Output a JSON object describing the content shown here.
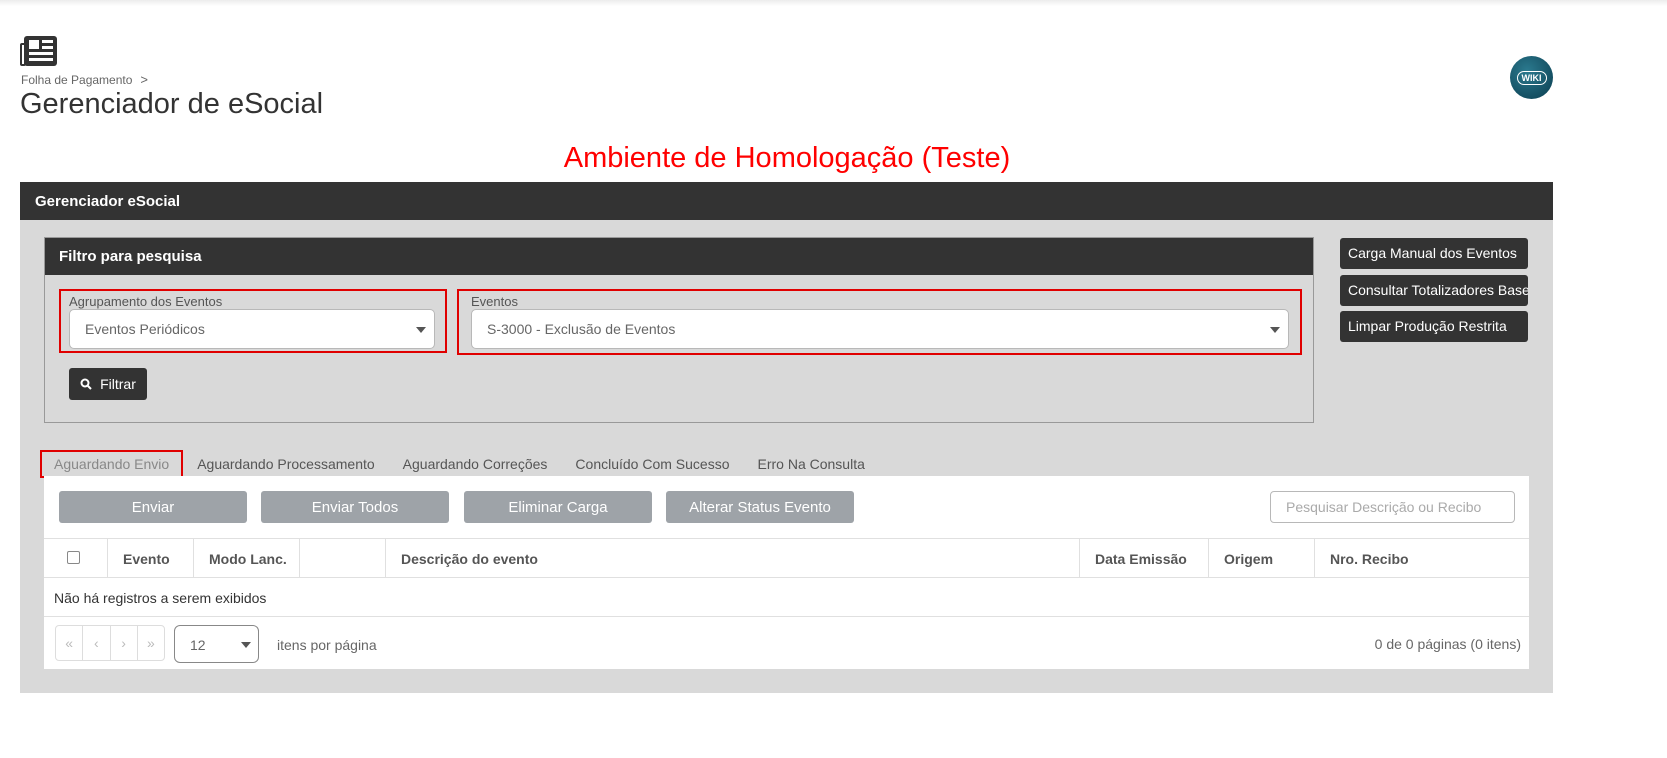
{
  "header": {
    "breadcrumb": "Folha de Pagamento",
    "breadcrumb_sep": ">",
    "title": "Gerenciador de eSocial",
    "wiki_label": "WIKI"
  },
  "environment_banner": "Ambiente de Homologação (Teste)",
  "panel": {
    "title": "Gerenciador eSocial",
    "filter": {
      "title": "Filtro para pesquisa",
      "grouping_label": "Agrupamento dos Eventos",
      "grouping_value": "Eventos Periódicos",
      "events_label": "Eventos",
      "events_value": "S-3000 - Exclusão de Eventos",
      "filter_button": "Filtrar"
    },
    "side_buttons": [
      "Carga Manual dos Eventos",
      "Consultar Totalizadores Base",
      "Limpar Produção Restrita"
    ]
  },
  "tabs": [
    "Aguardando Envio",
    "Aguardando Processamento",
    "Aguardando Correções",
    "Concluído Com Sucesso",
    "Erro Na Consulta"
  ],
  "active_tab": "Aguardando Envio",
  "actions": [
    "Enviar",
    "Enviar Todos",
    "Eliminar Carga",
    "Alterar Status Evento"
  ],
  "search": {
    "placeholder": "Pesquisar Descrição ou Recibo"
  },
  "grid": {
    "columns": [
      "Evento",
      "Modo Lanc.",
      "",
      "Descrição do evento",
      "Data Emissão",
      "Origem",
      "Nro. Recibo"
    ],
    "empty_message": "Não há registros a serem exibidos"
  },
  "pager": {
    "buttons": [
      "«",
      "‹",
      "›",
      "»"
    ],
    "page_size": "12",
    "per_page_label": "itens por página",
    "info": "0 de 0 páginas (0 itens)"
  },
  "colors": {
    "accent_dark": "#333333",
    "alert_red": "#e00000",
    "panel_bg": "#d9d9d9",
    "disabled_button": "#9ea3a8"
  }
}
